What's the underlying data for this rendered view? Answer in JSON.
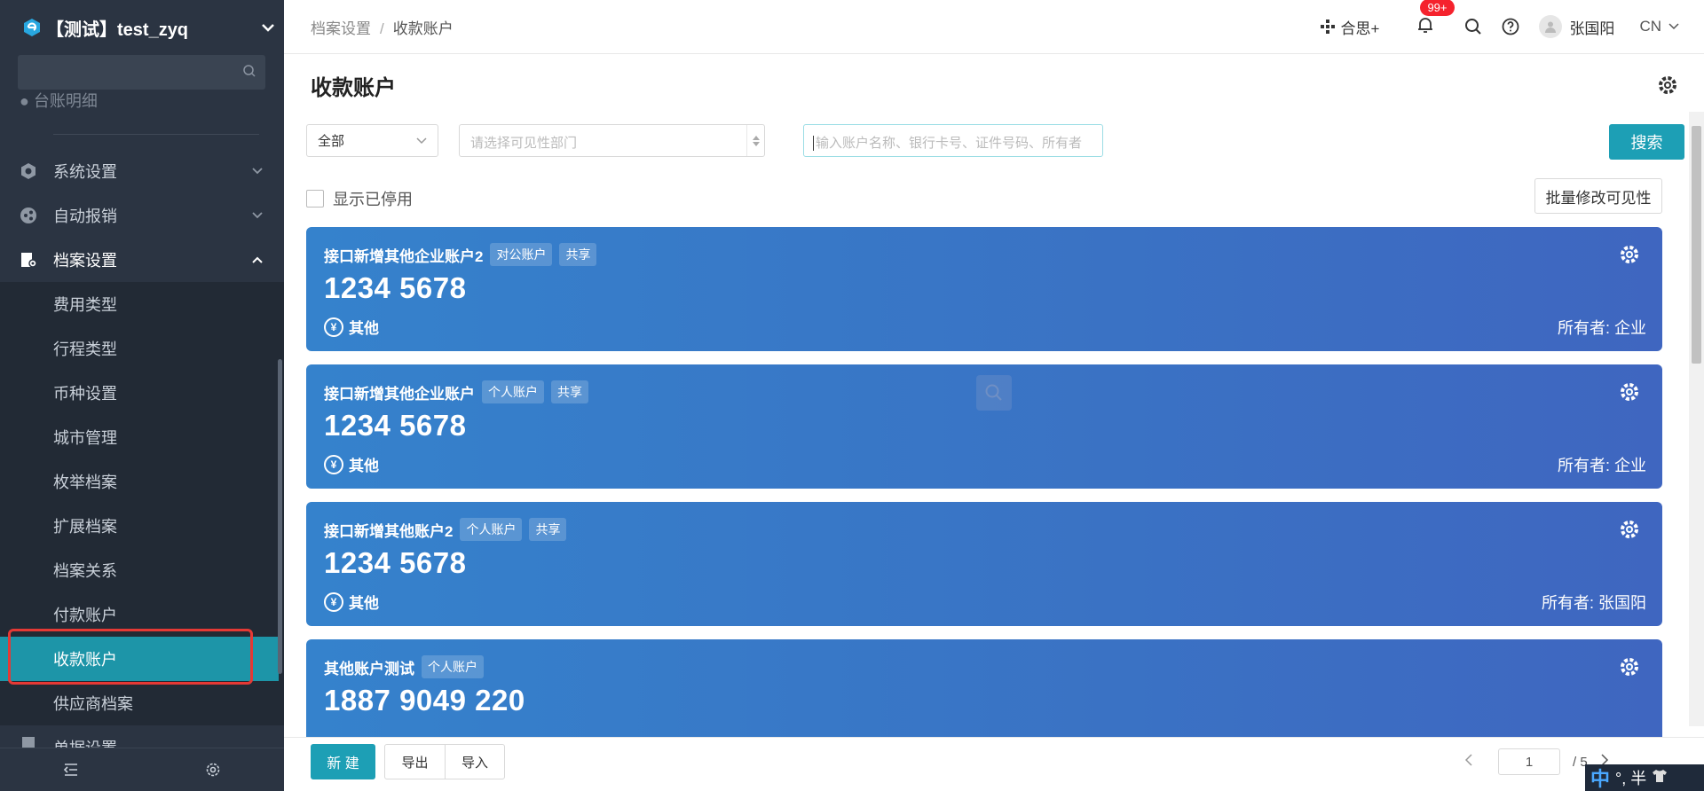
{
  "app": {
    "title": "【测试】test_zyq"
  },
  "sidebar": {
    "search_placeholder": "",
    "partial_item": "台账明细",
    "menu": [
      {
        "label": "系统设置",
        "icon": "gear-hex-icon"
      },
      {
        "label": "自动报销",
        "icon": "share-icon"
      },
      {
        "label": "档案设置",
        "icon": "archive-icon"
      }
    ],
    "sub_items": [
      "费用类型",
      "行程类型",
      "币种设置",
      "城市管理",
      "枚举档案",
      "扩展档案",
      "档案关系",
      "付款账户",
      "收款账户",
      "供应商档案"
    ],
    "bottom_partial": "单据设置"
  },
  "header": {
    "breadcrumb": [
      "档案设置",
      "收款账户"
    ],
    "hesi": "合思+",
    "badge": "99+",
    "user": "张国阳",
    "lang": "CN"
  },
  "page": {
    "title": "收款账户",
    "filter_select": "全部",
    "dept_placeholder": "请选择可见性部门",
    "keyword_placeholder": "输入账户名称、银行卡号、证件号码、所有者",
    "search_button": "搜索",
    "show_disabled": "显示已停用",
    "batch_button": "批量修改可见性"
  },
  "cards": [
    {
      "name": "接口新增其他企业账户2",
      "tags": [
        "对公账户",
        "共享"
      ],
      "number": "1234 5678",
      "type": "其他",
      "owner": "所有者: 企业"
    },
    {
      "name": "接口新增其他企业账户",
      "tags": [
        "个人账户",
        "共享"
      ],
      "number": "1234 5678",
      "type": "其他",
      "owner": "所有者: 企业"
    },
    {
      "name": "接口新增其他账户2",
      "tags": [
        "个人账户",
        "共享"
      ],
      "number": "1234 5678",
      "type": "其他",
      "owner": "所有者: 张国阳"
    },
    {
      "name": "其他账户测试",
      "tags": [
        "个人账户"
      ],
      "number": "1887 9049 220",
      "type": "",
      "owner": ""
    }
  ],
  "footer": {
    "new_button": "新 建",
    "export_button": "导出",
    "import_button": "导入",
    "page_current": "1",
    "page_total": "/ 5"
  },
  "ime": {
    "zh": "中",
    "rest": "°, 半"
  },
  "colors": {
    "sidebar_bg": "#2b3442",
    "accent": "#1d9fb5",
    "card_blue": "#3a72c4",
    "badge_red": "#f5222d"
  }
}
